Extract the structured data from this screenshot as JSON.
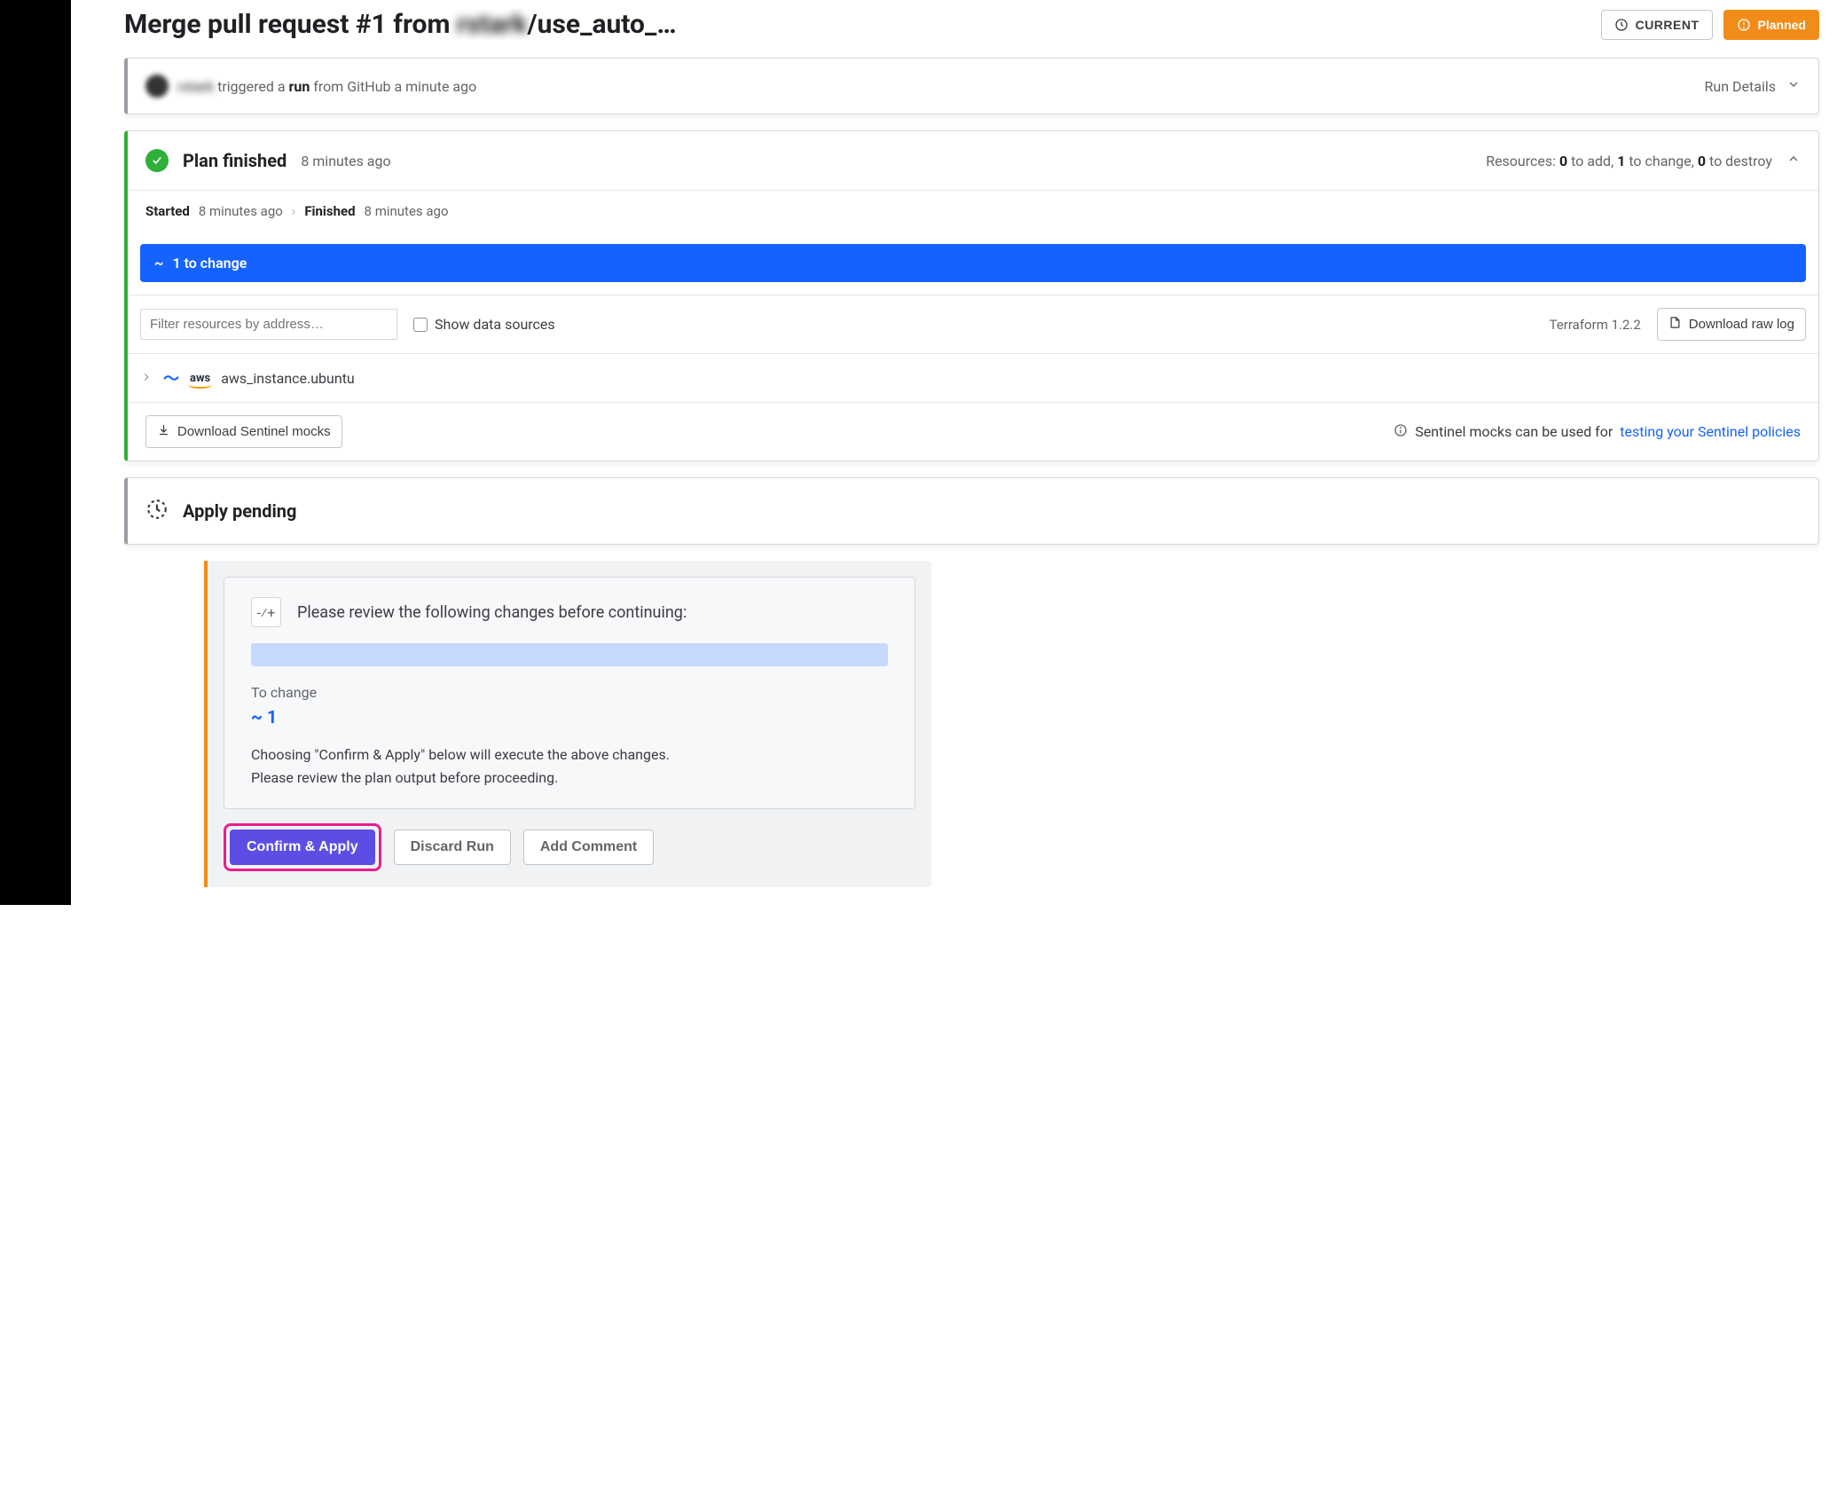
{
  "header": {
    "title_prefix": "Merge pull request #1 from ",
    "title_blur": "rstark",
    "title_suffix": "/use_auto_…",
    "current_label": "CURRENT",
    "planned_label": "Planned"
  },
  "trigger": {
    "username_blur": "rstark",
    "text_1": " triggered a ",
    "bold": "run",
    "text_2": " from GitHub a minute ago",
    "run_details_label": "Run Details"
  },
  "plan": {
    "title": "Plan finished",
    "time": "8 minutes ago",
    "summary_prefix": "Resources: ",
    "to_add": "0",
    "to_add_label": " to add, ",
    "to_change": "1",
    "to_change_label": " to change, ",
    "to_destroy": "0",
    "to_destroy_label": " to destroy",
    "started_label": "Started",
    "started_time": "8 minutes ago",
    "finished_label": "Finished",
    "finished_time": "8 minutes ago",
    "banner_tilde": "~",
    "banner_text": "1 to change",
    "filter_placeholder": "Filter resources by address…",
    "show_data_sources": "Show data sources",
    "tf_version": "Terraform 1.2.2",
    "download_log": "Download raw log",
    "resource_aws": "aws",
    "resource_name": "aws_instance.ubuntu",
    "download_sentinel": "Download Sentinel mocks",
    "sentinel_text": "Sentinel mocks can be used for ",
    "sentinel_link": "testing your Sentinel policies"
  },
  "apply": {
    "title": "Apply pending"
  },
  "callout": {
    "plus_minus": "-⁄+",
    "review_text": "Please review the following changes before continuing:",
    "to_change_label": "To change",
    "tilde_count": "~ 1",
    "p1": "Choosing \"Confirm & Apply\" below will execute the above changes.",
    "p2": "Please review the plan output before proceeding.",
    "confirm_label": "Confirm & Apply",
    "discard_label": "Discard Run",
    "comment_label": "Add Comment"
  }
}
